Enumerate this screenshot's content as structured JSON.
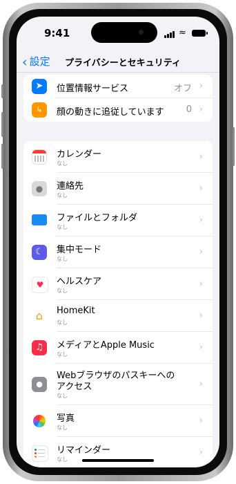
{
  "status_bar": {
    "time": "9:41"
  },
  "nav": {
    "back_label": "設定",
    "title": "プライバシーとセキュリティ"
  },
  "top_group": [
    {
      "label": "位置情報サービス",
      "value": "オフ",
      "icon": "location-arrow-icon",
      "color": "#007aff"
    },
    {
      "label": "顔の動きに追従しています",
      "value": "0",
      "icon": "face-tracking-icon",
      "color": "#ff9500"
    }
  ],
  "apps": [
    {
      "label": "カレンダー",
      "sub": "なし",
      "icon": "calendar-icon"
    },
    {
      "label": "連絡先",
      "sub": "なし",
      "icon": "contacts-icon"
    },
    {
      "label": "ファイルとフォルダ",
      "sub": "なし",
      "icon": "folder-icon"
    },
    {
      "label": "集中モード",
      "sub": "なし",
      "icon": "focus-moon-icon"
    },
    {
      "label": "ヘルスケア",
      "sub": "なし",
      "icon": "health-heart-icon"
    },
    {
      "label": "HomeKit",
      "sub": "なし",
      "icon": "home-icon"
    },
    {
      "label": "メディアとApple Music",
      "sub": "なし",
      "icon": "music-note-icon"
    },
    {
      "label_line1": "Webブラウザのパスキーへの",
      "label_line2": "アクセス",
      "sub": "なし",
      "icon": "passkey-icon"
    },
    {
      "label": "写真",
      "sub": "なし",
      "icon": "photos-flower-icon"
    },
    {
      "label": "リマインダー",
      "sub": "なし",
      "icon": "reminders-icon"
    }
  ]
}
